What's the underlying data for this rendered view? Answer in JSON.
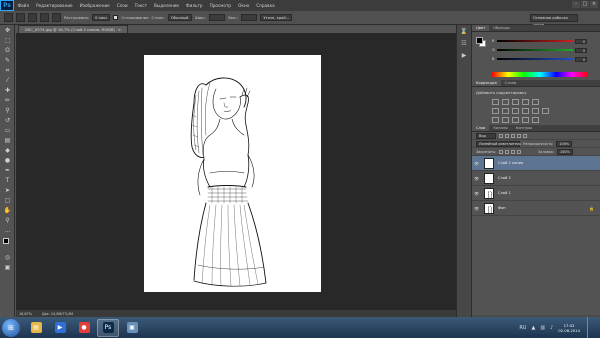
{
  "menu": {
    "logo": "Ps",
    "items": [
      "Файл",
      "Редактирование",
      "Изображение",
      "Слои",
      "Текст",
      "Выделение",
      "Фильтр",
      "Просмотр",
      "Окно",
      "Справка"
    ]
  },
  "options": {
    "feather_label": "Растушевка:",
    "feather_value": "0 пикс",
    "antialias_label": "Сглаживание",
    "style_label": "Стиль:",
    "style_value": "Обычный",
    "width_label": "Шир.:",
    "height_label": "Выс.:",
    "refine_label": "Уточн. край...",
    "workspace": "Основная рабочая среда"
  },
  "document": {
    "tab_title": "DSC_0574.jpg @ 16,7% (Слой 2 копия, RGB/8)",
    "tab_close": "×"
  },
  "status": {
    "zoom": "16,67%",
    "doc_size": "Док: 10,8M/73,4M"
  },
  "color_panel": {
    "tabs": [
      "Цвет",
      "Образцы"
    ],
    "channels": [
      {
        "label": "R",
        "value": "0",
        "color": "#cc2020"
      },
      {
        "label": "G",
        "value": "0",
        "color": "#20aa30"
      },
      {
        "label": "B",
        "value": "0",
        "color": "#2050cc"
      }
    ]
  },
  "adjust_panel": {
    "tabs": [
      "Коррекция",
      "Стили"
    ],
    "title": "Добавить корректировку"
  },
  "layers_panel": {
    "tabs": [
      "Слои",
      "Каналы",
      "Контуры"
    ],
    "kind_label": "Вид",
    "blend_mode": "Линейный осветлитель",
    "opacity_label": "Непрозрачность:",
    "opacity_value": "100%",
    "lock_label": "Закрепить:",
    "fill_label": "Заливка:",
    "fill_value": "100%",
    "layers": [
      {
        "name": "Слой 2 копия",
        "selected": true,
        "thumb": "white"
      },
      {
        "name": "Слой 2",
        "selected": false,
        "thumb": "white"
      },
      {
        "name": "Слой 1",
        "selected": false,
        "thumb": "photo"
      },
      {
        "name": "Фон",
        "selected": false,
        "thumb": "photo",
        "locked": true
      }
    ]
  },
  "taskbar": {
    "apps": [
      {
        "name": "windows-explorer",
        "glyph": "▤",
        "color": "#e6b84a"
      },
      {
        "name": "media-player",
        "glyph": "▶",
        "color": "#2f6fd6"
      },
      {
        "name": "chrome",
        "glyph": "●",
        "color": "#e0403a"
      },
      {
        "name": "photoshop",
        "glyph": "Ps",
        "color": "#0b2a4a",
        "active": true
      },
      {
        "name": "image-viewer",
        "glyph": "▣",
        "color": "#6a8fb8"
      }
    ],
    "lang": "RU",
    "time": "17:52",
    "date": "02.06.2014"
  }
}
